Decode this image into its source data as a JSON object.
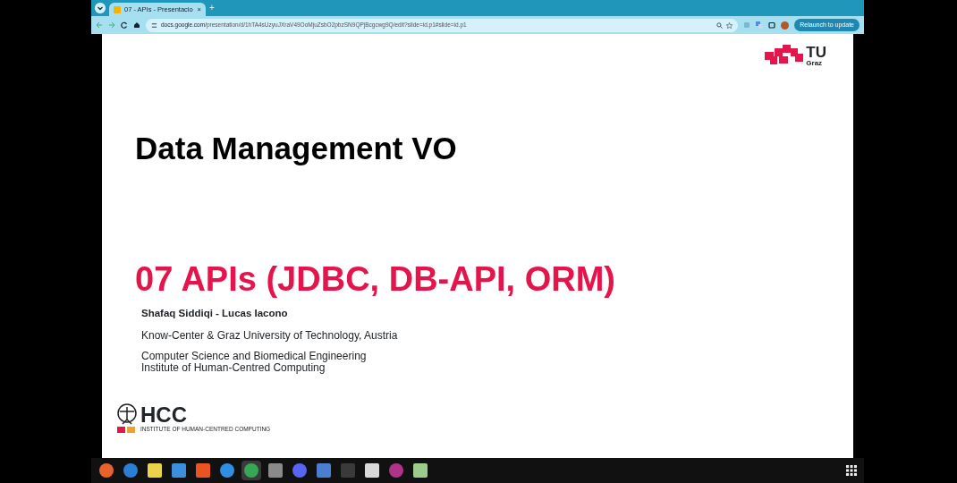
{
  "browser": {
    "tab": {
      "title": "07 - APIs - Presentacio",
      "close": "×"
    },
    "new_tab": "+",
    "url_domain": "docs.google.com",
    "url_path": "/presentation/d/1hTA4sUzyuJXraV49OoMjuZsbO2pbzSN9QPjBcgcwg9Q/edit?slide=id.p1#slide=id.p1",
    "relaunch_button": "Relaunch to update"
  },
  "slide": {
    "logo_text": "TU",
    "logo_subtext": "Graz",
    "title": "Data Management VO",
    "subtitle": "07 APIs (JDBC, DB-API, ORM)",
    "authors": "Shafaq Siddiqi - Lucas Iacono",
    "affiliation": "Know-Center & Graz University of Technology, Austria",
    "department_lines": [
      "Computer Science and Biomedical Engineering",
      "Institute of Human-Centred Computing"
    ],
    "hcc_logo_text": "HCC",
    "hcc_logo_caption": "INSTITUTE OF HUMAN-CENTRED COMPUTING"
  },
  "taskbar": {
    "apps": [
      {
        "kind": "round",
        "color": "#e8622c",
        "selected": false
      },
      {
        "kind": "round",
        "color": "#2a7fd4",
        "selected": false
      },
      {
        "kind": "square",
        "color": "#e9d44a",
        "selected": false
      },
      {
        "kind": "square",
        "color": "#3b8fdc",
        "selected": false
      },
      {
        "kind": "square",
        "color": "#e95420",
        "selected": false
      },
      {
        "kind": "round",
        "color": "#2f8fe0",
        "selected": false
      },
      {
        "kind": "round",
        "color": "#34a853",
        "selected": true
      },
      {
        "kind": "square",
        "color": "#8a8a8a",
        "selected": false
      },
      {
        "kind": "round",
        "color": "#5865f2",
        "selected": false
      },
      {
        "kind": "square",
        "color": "#4a7fd0",
        "selected": false
      },
      {
        "kind": "square",
        "color": "#3a3a3a",
        "selected": false
      },
      {
        "kind": "square",
        "color": "#d9d9d9",
        "selected": false
      },
      {
        "kind": "round",
        "color": "#b0338a",
        "selected": false
      },
      {
        "kind": "square",
        "color": "#9ccc8a",
        "selected": false
      }
    ]
  }
}
